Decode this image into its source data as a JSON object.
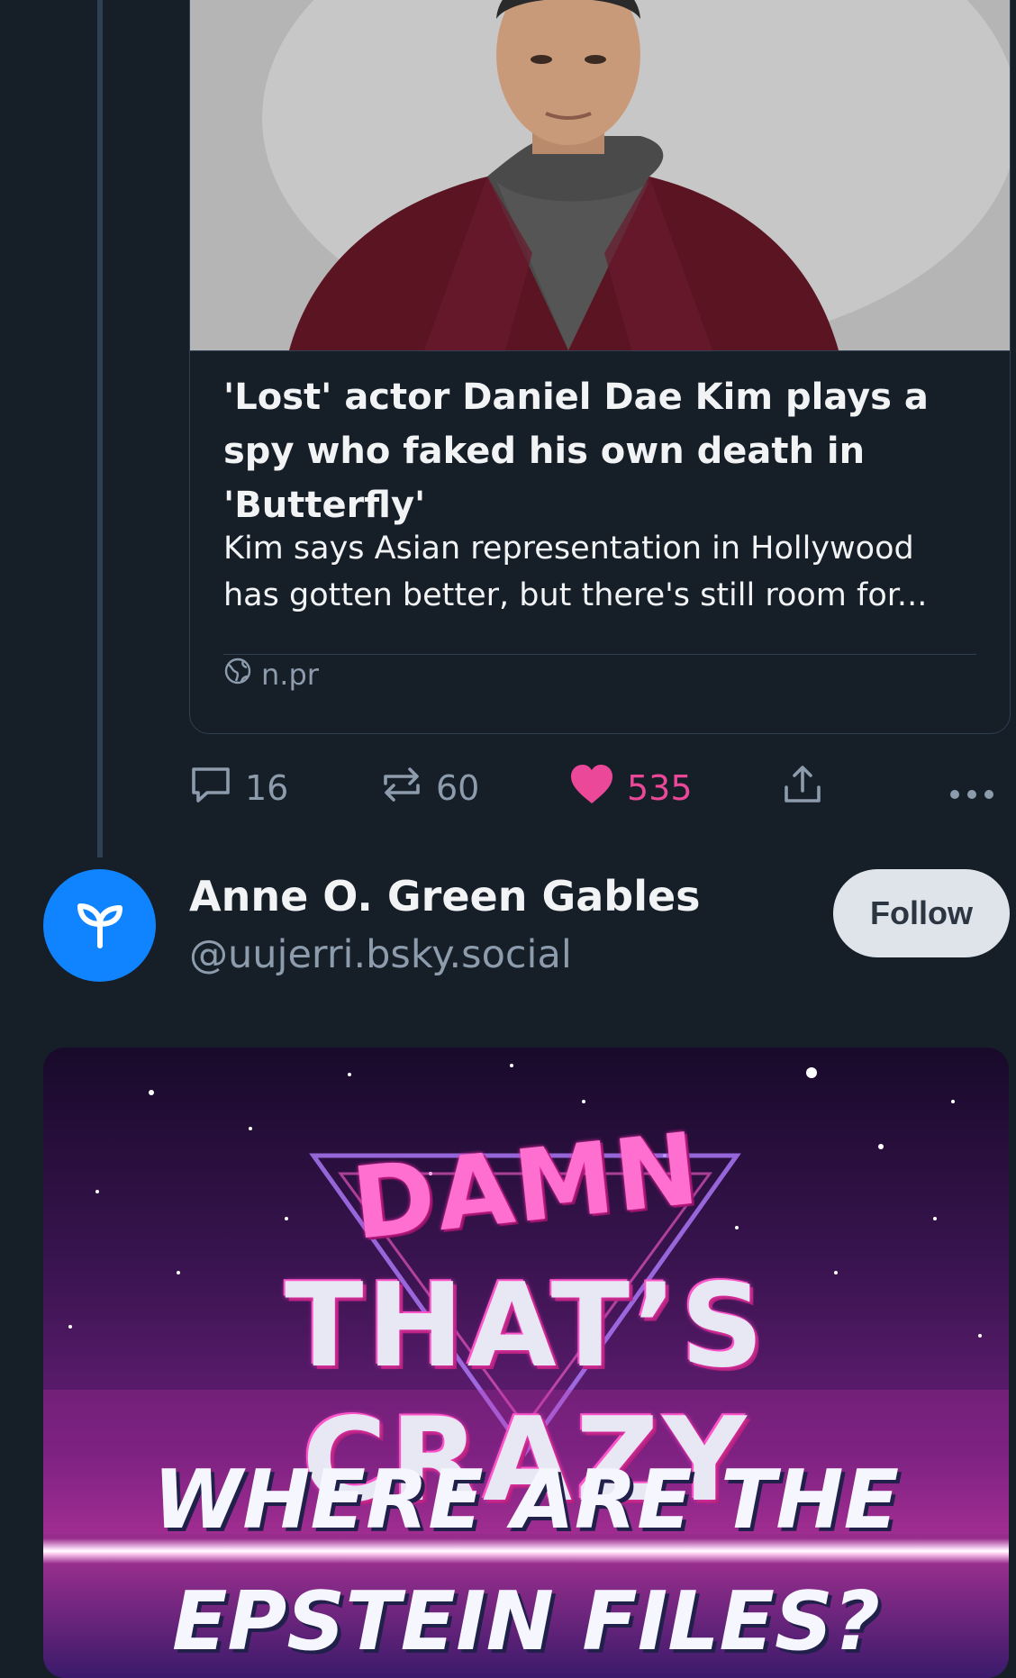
{
  "link_card": {
    "title": "'Lost' actor Daniel Dae Kim plays a spy who faked his own death in 'Butterfly'",
    "description_line1": "Kim says Asian representation in Hollywood",
    "description_line2": "has gotten better, but there's still room for...",
    "domain": "n.pr",
    "domain_icon": "globe-icon"
  },
  "actions": {
    "reply_count": "16",
    "repost_count": "60",
    "like_count": "535",
    "like_color": "#ec4899"
  },
  "author": {
    "name": "Anne O. Green Gables",
    "handle": "@uujerri.bsky.social",
    "avatar_icon": "sprout-icon",
    "avatar_color": "#1083fe",
    "follow_label": "Follow"
  },
  "meme": {
    "line1": "DAMN",
    "line2": "THAT’S CRAZY",
    "line3": "WHERE ARE THE",
    "line4": "EPSTEIN FILES?"
  }
}
